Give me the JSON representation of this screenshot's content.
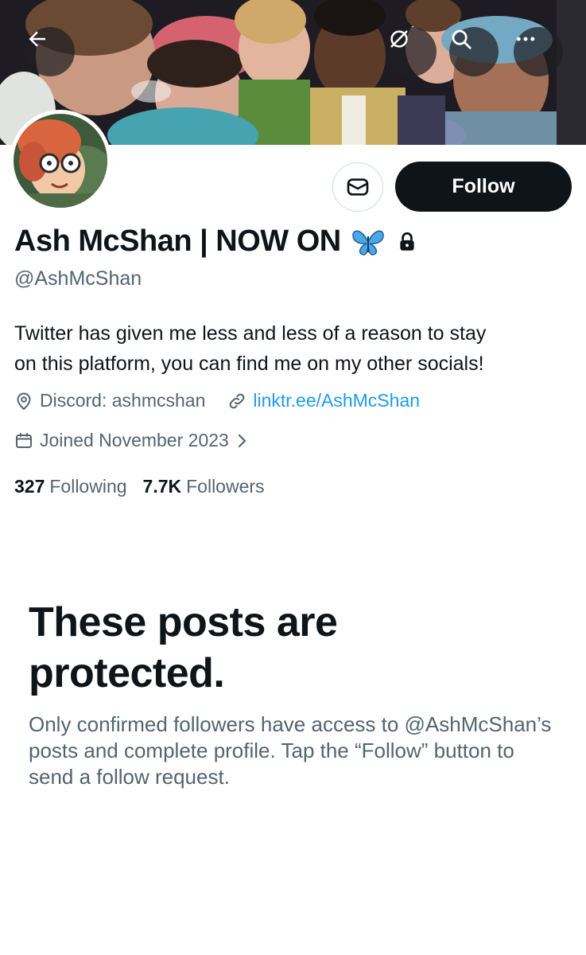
{
  "header": {
    "back_icon": "arrow-left-icon",
    "share_icon": "grok-icon",
    "search_icon": "search-icon",
    "more_icon": "more-icon"
  },
  "profile": {
    "display_name": "Ash McShan | NOW ON",
    "name_emoji": "butterfly-icon",
    "protected_icon": "lock-icon",
    "handle": "@AshMcShan",
    "bio_line1": "Twitter has given me less and less of a reason to stay",
    "bio_line2": "on this platform, you can find me on my other socials!",
    "location": "Discord: ashmcshan",
    "website": "linktr.ee/AshMcShan",
    "joined": "Joined November 2023",
    "following_count": "327",
    "following_label": "Following",
    "followers_count": "7.7K",
    "followers_label": "Followers"
  },
  "actions": {
    "message_icon": "message-icon",
    "follow_label": "Follow"
  },
  "protected": {
    "title": "These posts are protected.",
    "body": "Only confirmed followers have access to @AshMcShan’s posts and complete profile. Tap the “Follow” button to send a follow request."
  },
  "colors": {
    "text_primary": "#0f1419",
    "text_secondary": "#536471",
    "link": "#1d9bf0",
    "follow_bg": "#0f1419",
    "border": "#cfd9de"
  }
}
